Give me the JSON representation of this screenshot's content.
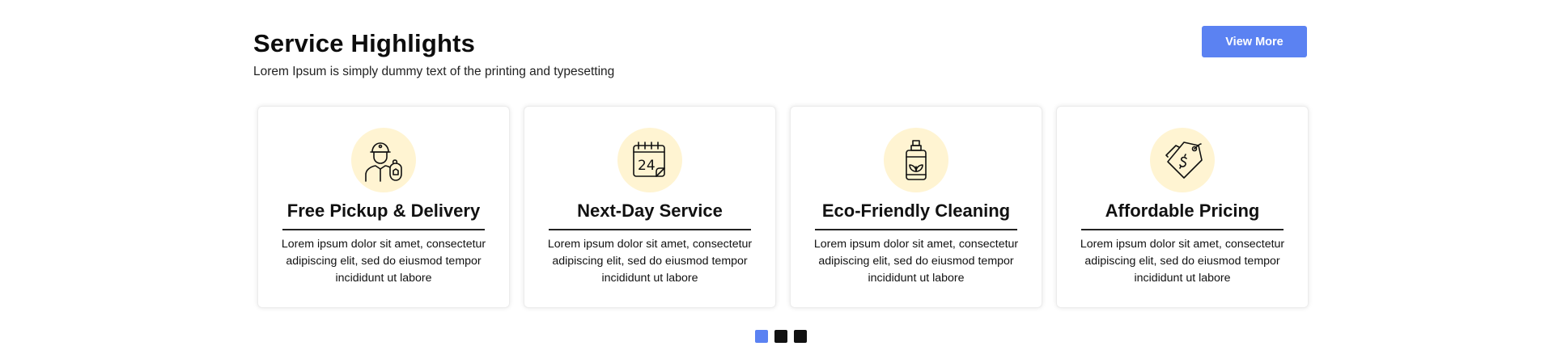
{
  "header": {
    "title": "Service Highlights",
    "subtitle": "Lorem Ipsum is simply dummy text of the printing and typesetting",
    "view_more_label": "View More"
  },
  "colors": {
    "accent": "#5b82f2",
    "icon_bg": "#fff4d2",
    "dot_inactive": "#111111"
  },
  "cards": [
    {
      "icon": "delivery-person-icon",
      "title": "Free Pickup & Delivery",
      "text": "Lorem ipsum dolor sit amet, consectetur adipiscing elit, sed do eiusmod tempor incididunt ut labore"
    },
    {
      "icon": "calendar-24-icon",
      "title": "Next-Day Service",
      "text": "Lorem ipsum dolor sit amet, consectetur adipiscing elit, sed do eiusmod tempor incididunt ut labore"
    },
    {
      "icon": "eco-bottle-icon",
      "title": "Eco-Friendly Cleaning",
      "text": "Lorem ipsum dolor sit amet, consectetur adipiscing elit, sed do eiusmod tempor incididunt ut labore"
    },
    {
      "icon": "price-tag-icon",
      "title": "Affordable Pricing",
      "text": "Lorem ipsum dolor sit amet, consectetur adipiscing elit, sed do eiusmod tempor incididunt ut labore"
    }
  ],
  "carousel": {
    "active_index": 0,
    "dot_count": 3
  }
}
